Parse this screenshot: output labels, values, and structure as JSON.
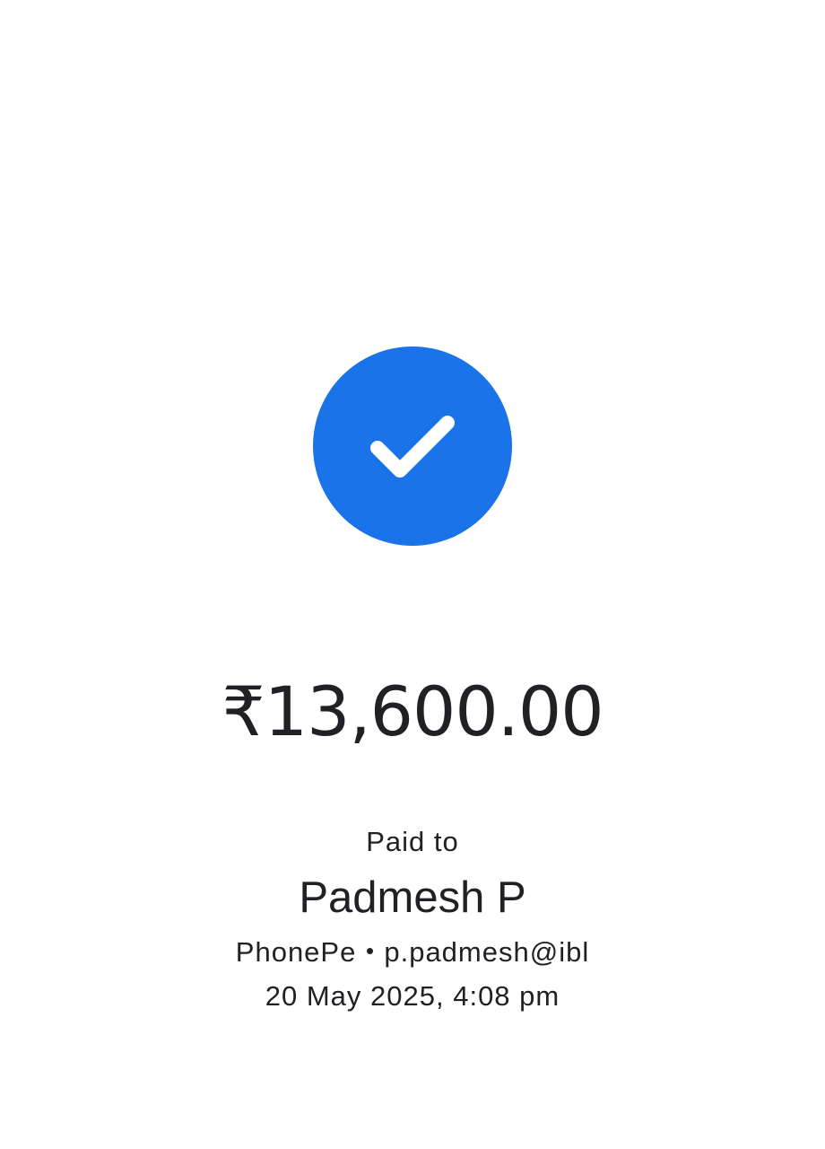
{
  "status": {
    "icon": "check-icon",
    "badge_color": "#1a73e8"
  },
  "payment": {
    "amount": "₹13,600.00",
    "paid_to_label": "Paid to",
    "payee_name": "Padmesh P",
    "payee_app": "PhonePe",
    "payee_upi_id": "p.padmesh@ibl",
    "timestamp": "20 May 2025, 4:08 pm"
  }
}
